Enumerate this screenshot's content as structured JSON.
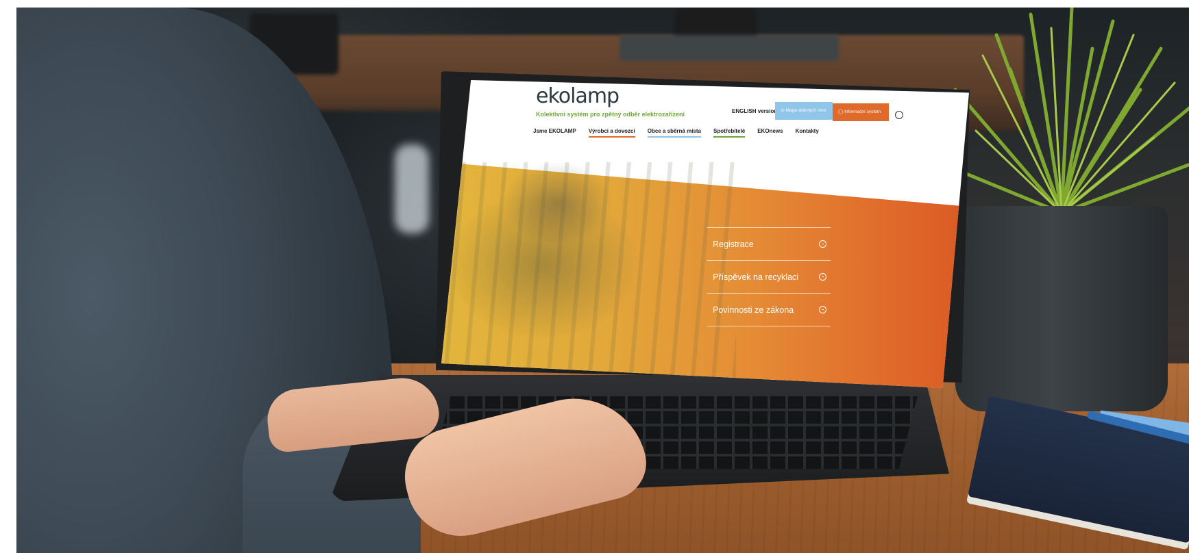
{
  "site": {
    "logo": "ekolamp",
    "tagline": "Kolektivní systém pro zpětný odběr elektrozařízení",
    "english_link": "ENGLISH version",
    "map_button": "Mapa sběrných míst",
    "info_button": "Informační systém"
  },
  "nav": {
    "items": [
      {
        "label": "Jsme EKOLAMP",
        "underline": ""
      },
      {
        "label": "Výrobci a dovozci",
        "underline": "#e06a2b"
      },
      {
        "label": "Obce a sběrná místa",
        "underline": "#8fc6e9"
      },
      {
        "label": "Spotřebitelé",
        "underline": "#6ea838"
      },
      {
        "label": "EKOnews",
        "underline": ""
      },
      {
        "label": "Kontakty",
        "underline": ""
      }
    ]
  },
  "hero_menu": {
    "items": [
      "Registrace",
      "Příspěvek na recyklaci",
      "Povinnosti ze zákona"
    ]
  },
  "colors": {
    "brand_green": "#6ea838",
    "brand_orange": "#e06a2b",
    "brand_blue": "#8fc6e9",
    "hero_yellow": "#e3b53c"
  }
}
